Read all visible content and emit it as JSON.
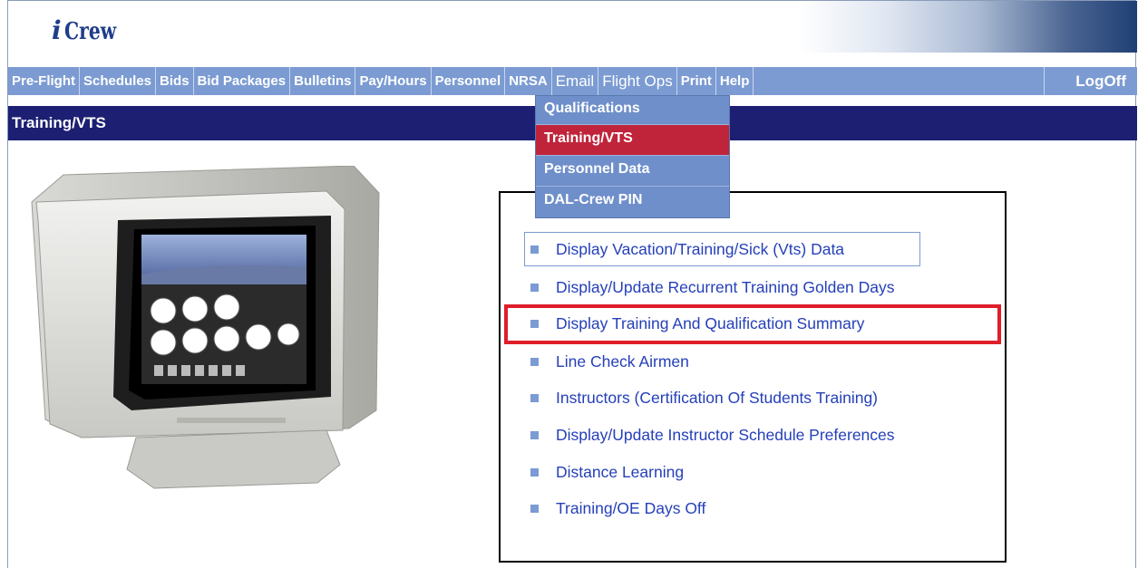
{
  "app": {
    "logo_i": "i",
    "logo_word": "Crew"
  },
  "nav": {
    "items": [
      {
        "label": "Pre-Flight"
      },
      {
        "label": "Schedules"
      },
      {
        "label": "Bids"
      },
      {
        "label": "Bid Packages"
      },
      {
        "label": "Bulletins"
      },
      {
        "label": "Pay/Hours"
      },
      {
        "label": "Personnel"
      },
      {
        "label": "NRSA"
      },
      {
        "label": "Email"
      },
      {
        "label": "Flight Ops"
      },
      {
        "label": "Print"
      },
      {
        "label": "Help"
      }
    ],
    "logoff": "LogOff"
  },
  "dropdown": {
    "items": [
      {
        "label": "Qualifications"
      },
      {
        "label": "Training/VTS"
      },
      {
        "label": "Personnel Data"
      },
      {
        "label": "DAL-Crew PIN"
      }
    ]
  },
  "page": {
    "title": "Training/VTS"
  },
  "links": [
    {
      "label": "Display Vacation/Training/Sick (Vts) Data"
    },
    {
      "label": "Display/Update Recurrent Training Golden Days"
    },
    {
      "label": "Display Training And Qualification Summary"
    },
    {
      "label": "Line Check Airmen"
    },
    {
      "label": "Instructors (Certification Of Students Training)"
    },
    {
      "label": "Display/Update Instructor Schedule Preferences"
    },
    {
      "label": "Distance Learning"
    },
    {
      "label": "Training/OE Days Off"
    }
  ],
  "colors": {
    "nav_bg": "#7b9bd2",
    "title_bg": "#1c1f72",
    "active_menu": "#c0243a",
    "link": "#2540b8",
    "highlight_box": "#e01e2a"
  }
}
